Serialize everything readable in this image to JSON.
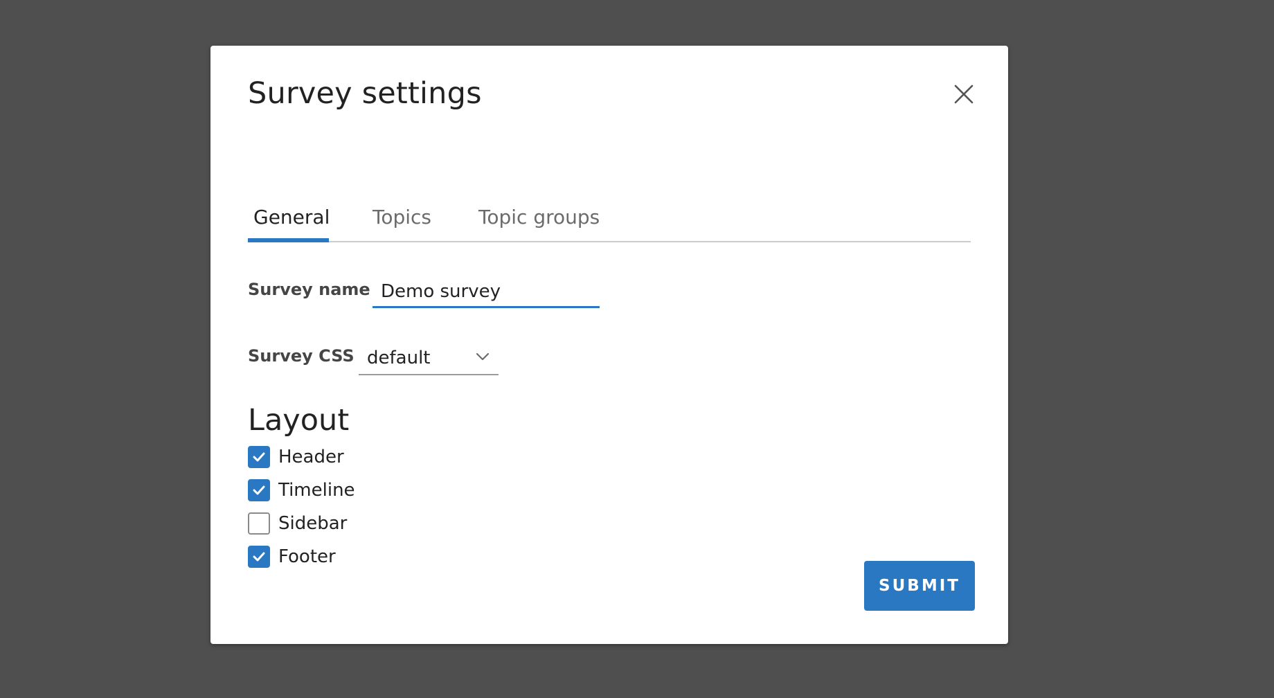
{
  "modal": {
    "title": "Survey settings",
    "close_icon": "close-icon"
  },
  "tabs": [
    {
      "label": "General",
      "active": true
    },
    {
      "label": "Topics",
      "active": false
    },
    {
      "label": "Topic groups",
      "active": false
    }
  ],
  "form": {
    "survey_name": {
      "label": "Survey name",
      "value": "Demo survey"
    },
    "survey_css": {
      "label": "Survey CSS",
      "selected": "default",
      "icon": "chevron-down-icon"
    }
  },
  "layout": {
    "heading": "Layout",
    "options": [
      {
        "label": "Header",
        "checked": true
      },
      {
        "label": "Timeline",
        "checked": true
      },
      {
        "label": "Sidebar",
        "checked": false
      },
      {
        "label": "Footer",
        "checked": true
      }
    ]
  },
  "submit": {
    "label": "SUBMIT"
  },
  "colors": {
    "accent": "#2b78c2",
    "backdrop": "#4f4f4f",
    "modal_bg": "#ffffff"
  }
}
